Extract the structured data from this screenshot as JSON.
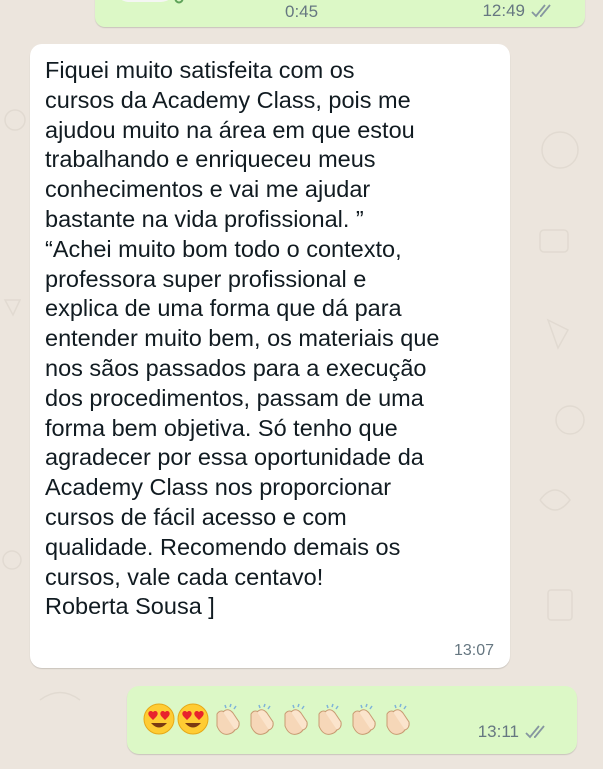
{
  "top_message": {
    "duration": "0:45",
    "time": "12:49",
    "status_icon": "double-check-icon"
  },
  "incoming_message": {
    "lines": [
      "Fiquei muito satisfeita com os",
      "cursos da Academy Class, pois me",
      "ajudou muito na área em que estou",
      "trabalhando e enriqueceu meus",
      "conhecimentos e vai me ajudar",
      "bastante na vida profissional. ”",
      "“Achei muito bom todo o contexto,",
      "professora super profissional e",
      "explica de uma forma que dá para",
      "entender muito bem, os materiais que",
      "nos sãos passados para a execução",
      "dos procedimentos, passam de uma",
      "forma bem objetiva. Só tenho que",
      "agradecer por essa oportunidade da",
      "Academy Class nos proporcionar",
      "cursos de fácil acesso e com",
      "qualidade. Recomendo demais os",
      "cursos, vale cada centavo!",
      "Roberta Sousa ]"
    ],
    "time": "13:07"
  },
  "outgoing_message": {
    "emojis": [
      "heart-eyes-emoji",
      "heart-eyes-emoji",
      "clapping-hands-emoji",
      "clapping-hands-emoji",
      "clapping-hands-emoji",
      "clapping-hands-emoji",
      "clapping-hands-emoji",
      "clapping-hands-emoji"
    ],
    "time": "13:11",
    "status_icon": "double-check-icon"
  },
  "colors": {
    "chat_background": "#ece5dd",
    "incoming_bubble": "#ffffff",
    "outgoing_bubble": "#dcf8c6",
    "timestamp": "#667781",
    "tick": "#8696a0"
  }
}
